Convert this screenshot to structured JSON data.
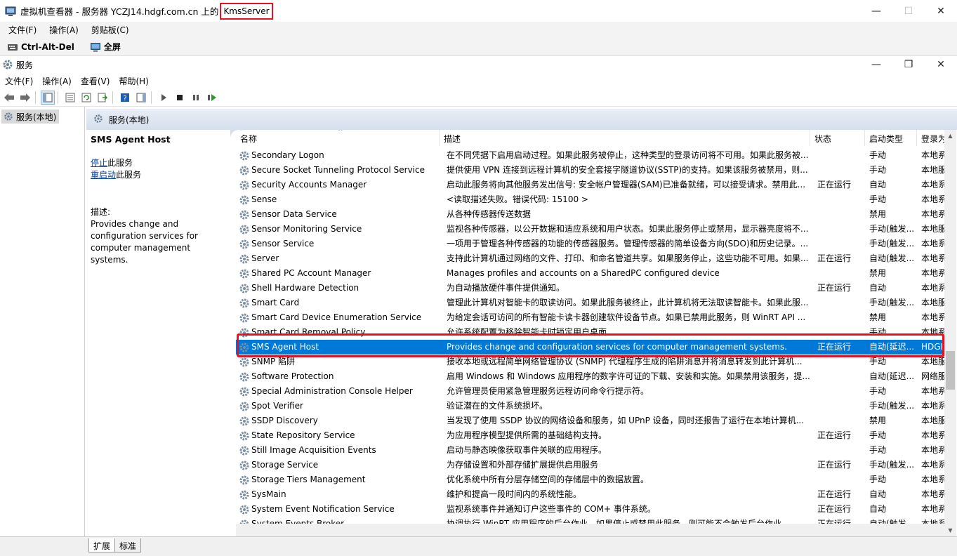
{
  "vm_window": {
    "title_prefix": "虚拟机查看器 - 服务器 YCZJ14.hdgf.com.cn 上的",
    "title_highlight": "KmsServer",
    "menu": [
      "文件(F)",
      "操作(A)",
      "剪贴板(C)"
    ],
    "toolbar": {
      "cad": "Ctrl-Alt-Del",
      "fullscreen": "全屏"
    },
    "buttons": {
      "minimize": "—",
      "maximize": "☐",
      "close": "✕"
    }
  },
  "services_window": {
    "title": "服务",
    "menu": [
      "文件(F)",
      "操作(A)",
      "查看(V)",
      "帮助(H)"
    ],
    "buttons": {
      "minimize": "—",
      "restore": "❐",
      "close": "✕"
    }
  },
  "tree": {
    "item": "服务(本地)"
  },
  "right_header": "服务(本地)",
  "detail": {
    "title": "SMS Agent Host",
    "stop_link": "停止",
    "stop_suffix": "此服务",
    "restart_link": "重启动",
    "restart_suffix": "此服务",
    "desc_label": "描述:",
    "desc_text": "Provides change and configuration services for computer management systems."
  },
  "columns": {
    "name": "名称",
    "desc": "描述",
    "status": "状态",
    "start": "启动类型",
    "logon": "登录为"
  },
  "services": [
    {
      "name": "Secondary Logon",
      "desc": "在不同凭据下启用启动过程。如果此服务被停止，这种类型的登录访问将不可用。如果此服务被...",
      "status": "",
      "start": "手动",
      "logon": "本地系"
    },
    {
      "name": "Secure Socket Tunneling Protocol Service",
      "desc": "提供使用 VPN 连接到远程计算机的安全套接字隧道协议(SSTP)的支持。如果该服务被禁用，则...",
      "status": "",
      "start": "手动",
      "logon": "本地服"
    },
    {
      "name": "Security Accounts Manager",
      "desc": "启动此服务将向其他服务发出信号: 安全帐户管理器(SAM)已准备就绪，可以接受请求。禁用此...",
      "status": "正在运行",
      "start": "自动",
      "logon": "本地系"
    },
    {
      "name": "Sense",
      "desc": "<读取描述失败。错误代码: 15100 >",
      "status": "",
      "start": "手动",
      "logon": "本地系"
    },
    {
      "name": "Sensor Data Service",
      "desc": "从各种传感器传送数据",
      "status": "",
      "start": "禁用",
      "logon": "本地系"
    },
    {
      "name": "Sensor Monitoring Service",
      "desc": "监视各种传感器，以公开数据和适应系统和用户状态。如果此服务停止或禁用，显示器亮度将不...",
      "status": "",
      "start": "手动(触发...",
      "logon": "本地服"
    },
    {
      "name": "Sensor Service",
      "desc": "一项用于管理各种传感器的功能的传感器服务。管理传感器的简单设备方向(SDO)和历史记录。...",
      "status": "",
      "start": "手动(触发...",
      "logon": "本地系"
    },
    {
      "name": "Server",
      "desc": "支持此计算机通过网络的文件、打印、和命名管道共享。如果服务停止，这些功能不可用。如果...",
      "status": "正在运行",
      "start": "自动(触发...",
      "logon": "本地系"
    },
    {
      "name": "Shared PC Account Manager",
      "desc": "Manages profiles and accounts on a SharedPC configured device",
      "status": "",
      "start": "禁用",
      "logon": "本地系"
    },
    {
      "name": "Shell Hardware Detection",
      "desc": "为自动播放硬件事件提供通知。",
      "status": "正在运行",
      "start": "自动",
      "logon": "本地系"
    },
    {
      "name": "Smart Card",
      "desc": "管理此计算机对智能卡的取读访问。如果此服务被终止，此计算机将无法取读智能卡。如果此服...",
      "status": "",
      "start": "手动(触发...",
      "logon": "本地服"
    },
    {
      "name": "Smart Card Device Enumeration Service",
      "desc": "为给定会话可访问的所有智能卡读卡器创建软件设备节点。如果已禁用此服务，则 WinRT API ...",
      "status": "",
      "start": "禁用",
      "logon": "本地系"
    },
    {
      "name": "Smart Card Removal Policy",
      "desc": "允许系统配置为移除智能卡时锁定用户桌面",
      "status": "",
      "start": "手动",
      "logon": "本地系"
    },
    {
      "name": "SMS Agent Host",
      "desc": "Provides change and configuration services for computer management systems.",
      "status": "正在运行",
      "start": "自动(延迟...",
      "logon": "HDGF"
    },
    {
      "name": "SNMP 陷阱",
      "desc": "接收本地或远程简单网络管理协议 (SNMP) 代理程序生成的陷阱消息并将消息转发到此计算机...",
      "status": "",
      "start": "手动",
      "logon": "本地服"
    },
    {
      "name": "Software Protection",
      "desc": "启用 Windows 和 Windows 应用程序的数字许可证的下载、安装和实施。如果禁用该服务，提...",
      "status": "",
      "start": "自动(延迟...",
      "logon": "网络服"
    },
    {
      "name": "Special Administration Console Helper",
      "desc": "允许管理员使用紧急管理服务远程访问命令行提示符。",
      "status": "",
      "start": "手动",
      "logon": "本地系"
    },
    {
      "name": "Spot Verifier",
      "desc": "验证潜在的文件系统损坏。",
      "status": "",
      "start": "手动(触发...",
      "logon": "本地系"
    },
    {
      "name": "SSDP Discovery",
      "desc": "当发现了使用 SSDP 协议的网络设备和服务，如 UPnP 设备，同时还报告了运行在本地计算机...",
      "status": "",
      "start": "禁用",
      "logon": "本地服"
    },
    {
      "name": "State Repository Service",
      "desc": "为应用程序模型提供所需的基础结构支持。",
      "status": "正在运行",
      "start": "手动",
      "logon": "本地系"
    },
    {
      "name": "Still Image Acquisition Events",
      "desc": "启动与静态映像获取事件关联的应用程序。",
      "status": "",
      "start": "手动",
      "logon": "本地系"
    },
    {
      "name": "Storage Service",
      "desc": "为存储设置和外部存储扩展提供启用服务",
      "status": "正在运行",
      "start": "手动(触发...",
      "logon": "本地系"
    },
    {
      "name": "Storage Tiers Management",
      "desc": "优化系统中所有分层存储空间的存储层中的数据放置。",
      "status": "",
      "start": "手动",
      "logon": "本地系"
    },
    {
      "name": "SysMain",
      "desc": "维护和提高一段时间内的系统性能。",
      "status": "正在运行",
      "start": "自动",
      "logon": "本地系"
    },
    {
      "name": "System Event Notification Service",
      "desc": "监视系统事件并通知订户这些事件的 COM+ 事件系统。",
      "status": "正在运行",
      "start": "自动",
      "logon": "本地系"
    },
    {
      "name": "System Events Broker",
      "desc": "协调执行 WinRT 应用程序的后台作业。如果停止或禁用此服务，则可能不会触发后台作业。",
      "status": "正在运行",
      "start": "自动(触发...",
      "logon": "本地系"
    }
  ],
  "selected_index": 13,
  "bottom_tabs": [
    "扩展",
    "标准"
  ]
}
